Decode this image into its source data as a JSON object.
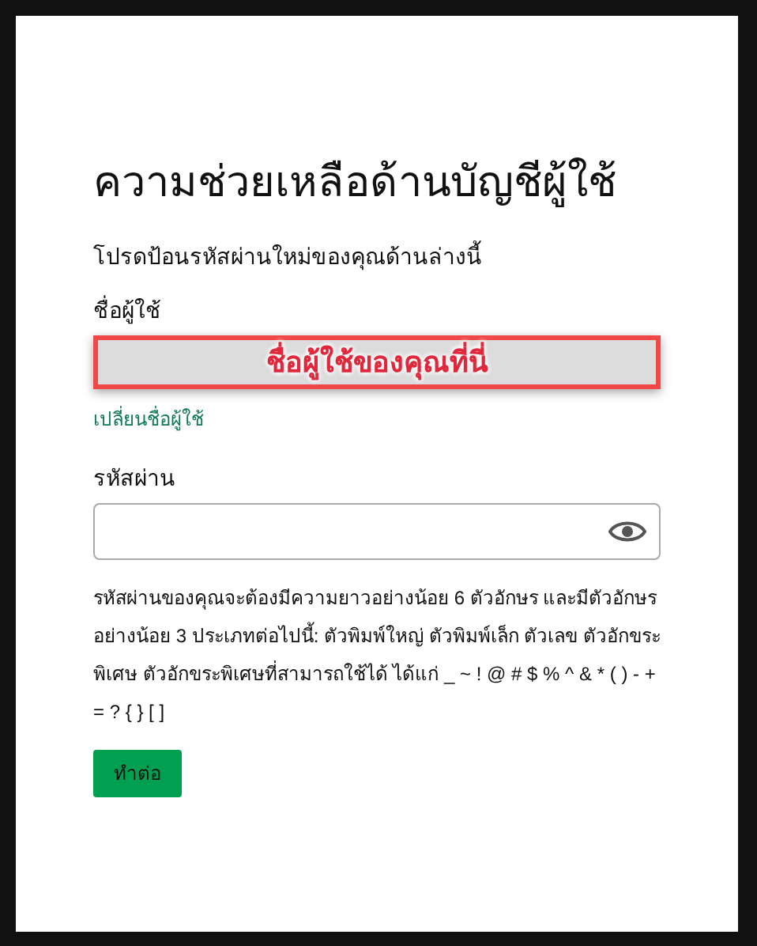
{
  "title": "ความช่วยเหลือด้านบัญชีผู้ใช้",
  "instruction": "โปรดป้อนรหัสผ่านใหม่ของคุณด้านล่างนี้",
  "username": {
    "label": "ชื่อผู้ใช้",
    "value": "ชื่อผู้ใช้ของคุณที่นี่",
    "highlighted": true
  },
  "change_username_link": "เปลี่ยนชื่อผู้ใช้",
  "password": {
    "label": "รหัสผ่าน"
  },
  "password_hint": "รหัสผ่านของคุณจะต้องมีความยาวอย่างน้อย 6 ตัวอักษร และมีตัวอักษรอย่างน้อย 3 ประเภทต่อไปนี้: ตัวพิมพ์ใหญ่ ตัวพิมพ์เล็ก ตัวเลข ตัวอักขระพิเศษ ตัวอักขระพิเศษที่สามารถใช้ได้ ได้แก่ _ ~ ! @ # $ % ^ & * ( ) - + = ? { } [ ]",
  "continue_button": "ทำต่อ"
}
